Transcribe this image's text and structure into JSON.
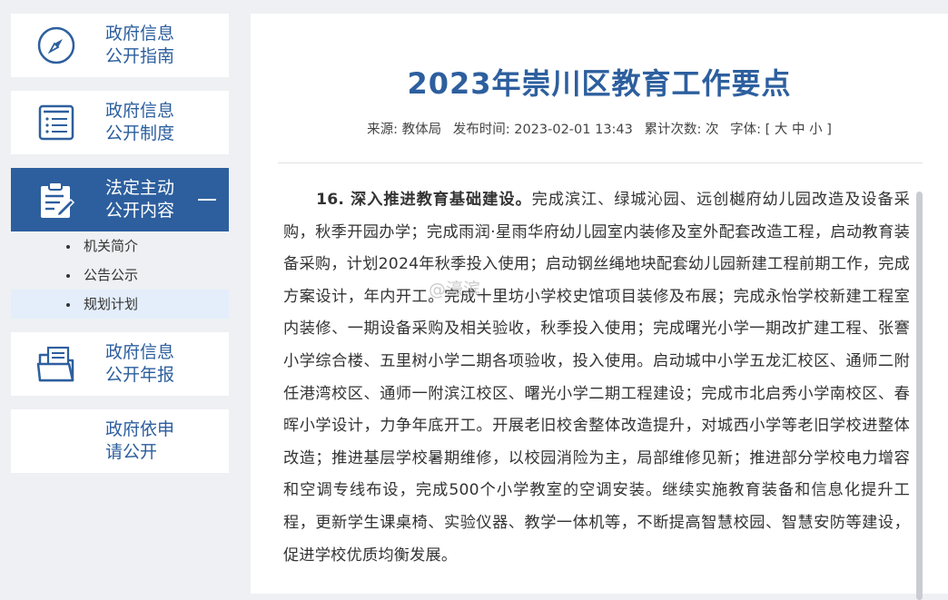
{
  "sidebar": {
    "items": [
      {
        "label": "政府信息\n公开指南",
        "icon": "compass-icon"
      },
      {
        "label": "政府信息\n公开制度",
        "icon": "list-document-icon"
      },
      {
        "label": "法定主动\n公开内容",
        "icon": "clipboard-edit-icon",
        "active": true
      },
      {
        "label": "政府信息\n公开年报",
        "icon": "folder-document-icon"
      },
      {
        "label": "政府依申\n请公开",
        "icon": ""
      }
    ],
    "sub_items": [
      "机关简介",
      "公告公示",
      "规划计划"
    ],
    "current_sub": "规划计划"
  },
  "article": {
    "title": "2023年崇川区教育工作要点",
    "meta": {
      "source_label": "来源:",
      "source": "教体局",
      "publish_label": "发布时间:",
      "publish_time": "2023-02-01 13:43",
      "views_label": "累计次数:",
      "views_unit": "次",
      "font_label": "字体:",
      "font_sizes": "[ 大 中 小 ]"
    },
    "heading": "16. 深入推进教育基础建设。",
    "body": "完成滨江、绿城沁园、远创樾府幼儿园改造及设备采购，秋季开园办学；完成雨润·星雨华府幼儿园室内装修及室外配套改造工程，启动教育装备采购，计划2024年秋季投入使用；启动钢丝绳地块配套幼儿园新建工程前期工作，完成方案设计，年内开工。完成十里坊小学校史馆项目装修及布展；完成永怡学校新建工程室内装修、一期设备采购及相关验收，秋季投入使用；完成曙光小学一期改扩建工程、张謇小学综合楼、五里树小学二期各项验收，投入使用。启动城中小学五龙汇校区、通师二附任港湾校区、通师一附滨江校区、曙光小学二期工程建设；完成市北启秀小学南校区、春晖小学设计，力争年底开工。开展老旧校舍整体改造提升，对城西小学等老旧学校进整体改造；推进基层学校暑期维修，以校园消险为主，局部维修见新；推进部分学校电力增容和空调专线布设，完成500个小学教室的空调安装。继续实施教育装备和信息化提升工程，更新学生课桌椅、实验仪器、教学一体机等，不断提高智慧校园、智慧安防等建设，促进学校优质均衡发展。"
  },
  "watermark": "@濠滨",
  "colors": {
    "brand": "#2d5f9e",
    "sub_highlight": "#e3eefa",
    "page_bg": "#eef0f3"
  }
}
